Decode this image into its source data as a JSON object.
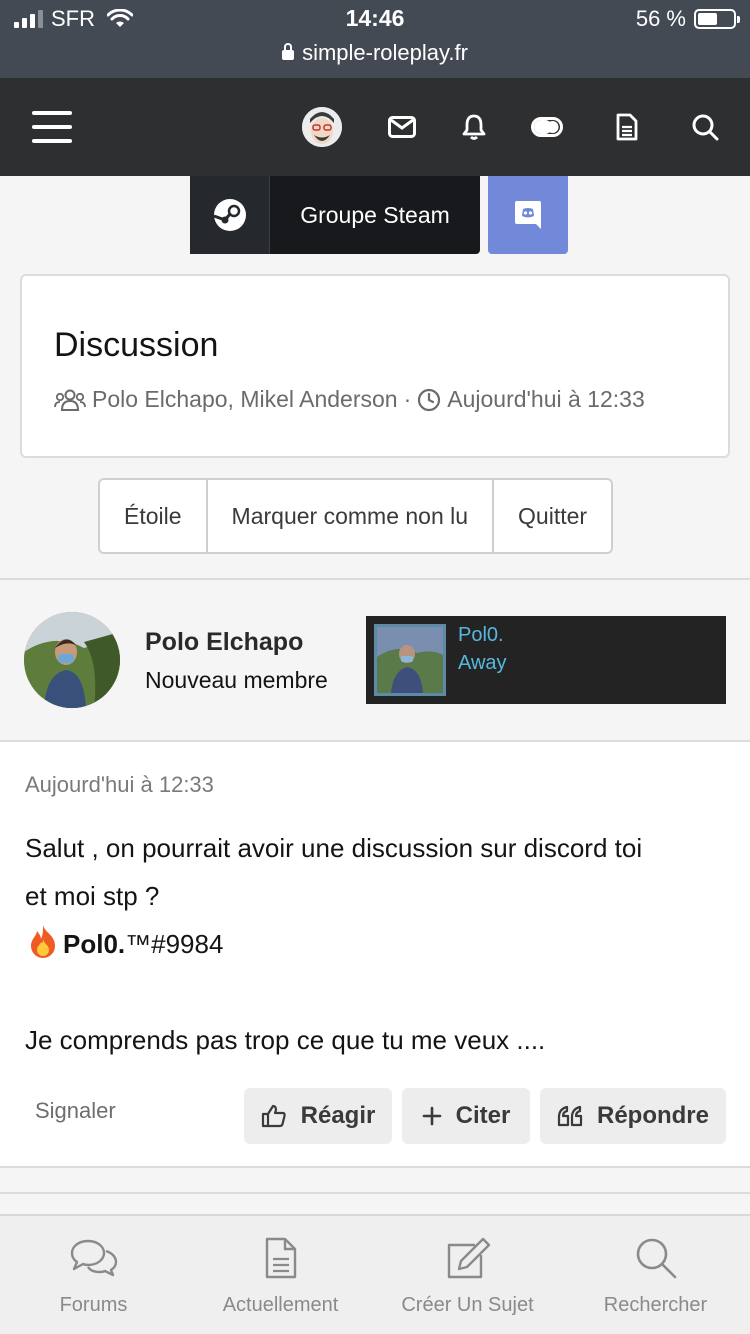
{
  "status_bar": {
    "carrier": "SFR",
    "time": "14:46",
    "battery_percent": "56 %",
    "battery_level": 0.56,
    "url": "simple-roleplay.fr"
  },
  "navbar": {
    "icons": [
      "menu-icon",
      "user-avatar",
      "mail-icon",
      "bell-icon",
      "toggle-icon",
      "document-icon",
      "search-icon"
    ]
  },
  "social": {
    "steam_label": "Groupe Steam"
  },
  "discussion": {
    "title": "Discussion",
    "participants": "Polo Elchapo, Mikel Anderson",
    "separator": "·",
    "date": "Aujourd'hui à 12:33"
  },
  "actions": {
    "star": "Étoile",
    "mark_unread": "Marquer comme non lu",
    "leave": "Quitter"
  },
  "author": {
    "name": "Polo Elchapo",
    "title": "Nouveau membre",
    "steam_name": "Pol0.",
    "steam_status": "Away"
  },
  "post": {
    "date": "Aujourd'hui à 12:33",
    "line1": "Salut , on pourrait avoir une discussion sur discord toi",
    "line2": "et moi stp ?",
    "line3_bold": "Pol0.",
    "line3_rest": "™#9984",
    "line4": "Je comprends pas trop ce que tu me veux ....",
    "report": "Signaler",
    "react": "Réagir",
    "quote": "Citer",
    "reply": "Répondre"
  },
  "tabbar": {
    "forums": "Forums",
    "current": "Actuellement",
    "create": "Créer Un Sujet",
    "search": "Rechercher"
  }
}
